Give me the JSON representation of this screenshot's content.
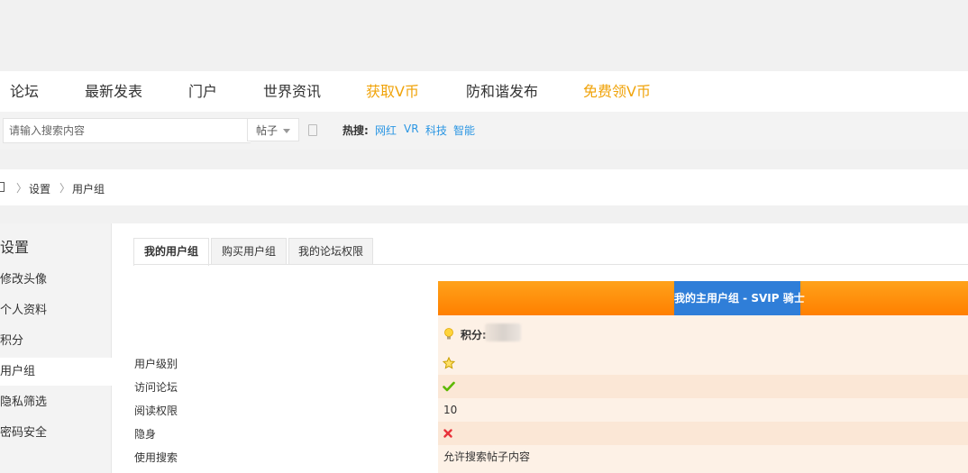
{
  "nav": {
    "items": [
      {
        "label": "论坛"
      },
      {
        "label": "最新发表"
      },
      {
        "label": "门户"
      },
      {
        "label": "世界资讯"
      },
      {
        "label": "获取V币"
      },
      {
        "label": "防和谐发布"
      },
      {
        "label": "免费领V币"
      }
    ],
    "highlight_color": "#f0a30a"
  },
  "search": {
    "placeholder": "请输入搜索内容",
    "type_selected": "帖子",
    "hot_label": "热搜:",
    "hot_links": [
      "网红",
      "VR",
      "科技",
      "智能"
    ]
  },
  "breadcrumb": [
    "设置",
    "用户组"
  ],
  "sidebar": {
    "title": "设置",
    "items": [
      {
        "label": "修改头像"
      },
      {
        "label": "个人资料"
      },
      {
        "label": "积分"
      },
      {
        "label": "用户组"
      },
      {
        "label": "隐私筛选"
      },
      {
        "label": "密码安全"
      }
    ]
  },
  "tabs": [
    {
      "label": "我的用户组"
    },
    {
      "label": "购买用户组"
    },
    {
      "label": "我的论坛权限"
    }
  ],
  "group": {
    "title": "我的主用户组 - SVIP 骑士",
    "points_label": "积分:",
    "rows": [
      {
        "label": "用户级别",
        "icon": "star-icon"
      },
      {
        "label": "访问论坛",
        "icon": "check-icon"
      },
      {
        "label": "阅读权限",
        "value": "10"
      },
      {
        "label": "隐身",
        "icon": "cross-icon"
      },
      {
        "label": "使用搜索",
        "value": "允许搜索帖子内容"
      }
    ]
  }
}
